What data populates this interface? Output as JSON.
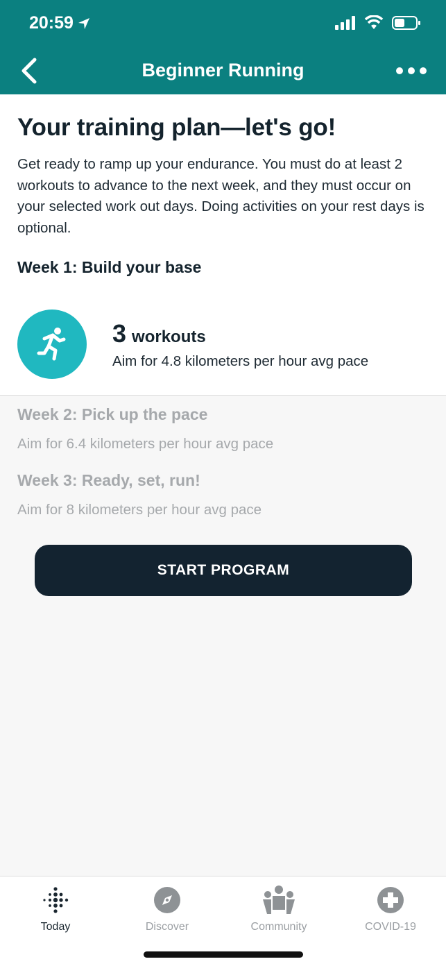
{
  "status_bar": {
    "time": "20:59"
  },
  "nav": {
    "title": "Beginner Running"
  },
  "intro": {
    "heading": "Your training plan—let's go!",
    "description": "Get ready to ramp up your endurance. You must do at least 2 workouts to advance to the next week, and they must occur on your selected work out days. Doing activities on your rest days is optional.",
    "current_week_title": "Week 1: Build your base"
  },
  "week1": {
    "workout_count": "3",
    "workout_label": "workouts",
    "pace": "Aim for 4.8 kilometers per hour avg pace"
  },
  "weeks": [
    {
      "title": "Week 2: Pick up the pace",
      "pace": "Aim for 6.4 kilometers per hour avg pace"
    },
    {
      "title": "Week 3: Ready, set, run!",
      "pace": "Aim for 8 kilometers per hour avg pace"
    }
  ],
  "start_button": "START PROGRAM",
  "tabs": [
    {
      "label": "Today",
      "icon": "fitbit-dots-icon",
      "active": true
    },
    {
      "label": "Discover",
      "icon": "compass-icon",
      "active": false
    },
    {
      "label": "Community",
      "icon": "community-icon",
      "active": false
    },
    {
      "label": "COVID-19",
      "icon": "plus-circle-icon",
      "active": false
    }
  ],
  "colors": {
    "header": "#0b8080",
    "accent_circle": "#20b8c0",
    "button": "#132330"
  }
}
